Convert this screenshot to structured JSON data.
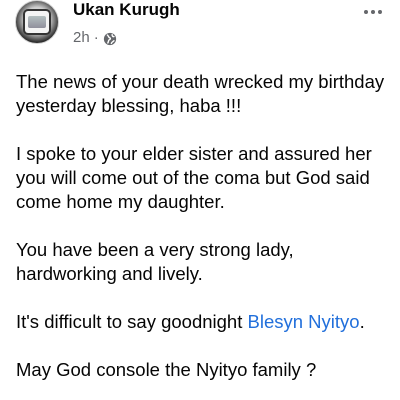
{
  "post": {
    "author": "Ukan Kurugh",
    "time": "2h",
    "separator": "·",
    "privacy_icon": "globe-icon",
    "more_icon": "more-options-icon",
    "paragraphs": [
      "The news of your death wrecked my birthday yesterday blessing, haba !!!",
      "I spoke to your elder sister and assured her you will come out of the coma but God said come home my daughter.",
      "You have been a very strong lady, hardworking and lively."
    ],
    "last_paragraph": {
      "text": "It's difficult to say goodnight ",
      "mention": "Blesyn Nyityo",
      "suffix": "."
    },
    "truncated_line": "May God console the Nyityo family ?"
  },
  "colors": {
    "text": "#050505",
    "meta": "#65676b",
    "link": "#216fdb"
  }
}
